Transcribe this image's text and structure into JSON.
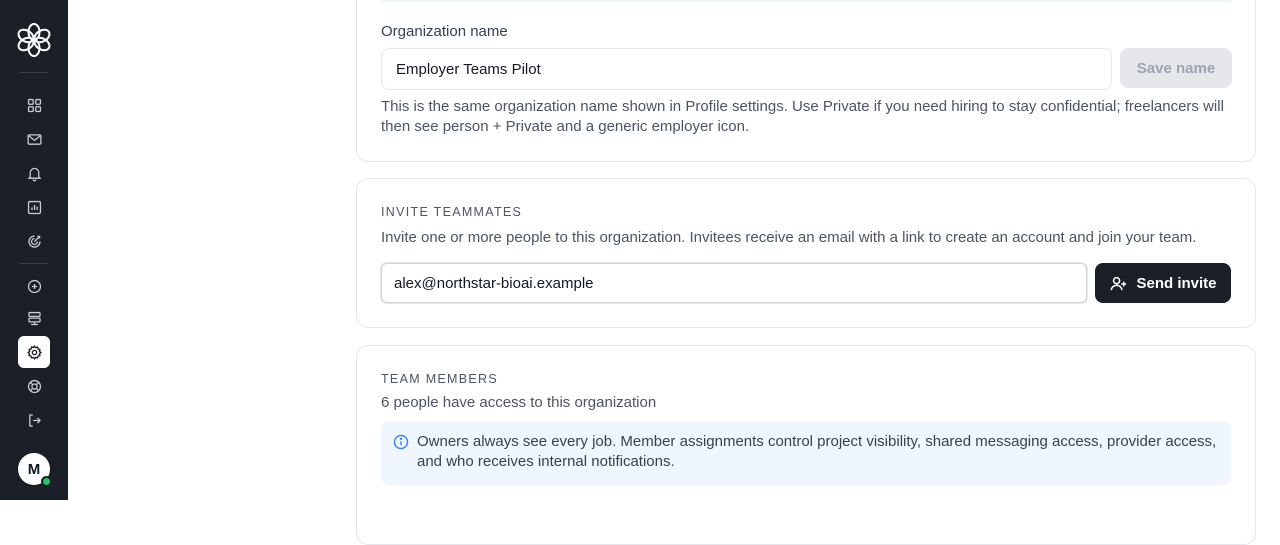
{
  "sidebar": {
    "avatar_initial": "M",
    "nav": [
      {
        "name": "dashboard",
        "icon": "grid-icon"
      },
      {
        "name": "messages",
        "icon": "mail-icon"
      },
      {
        "name": "notifications",
        "icon": "bell-icon"
      },
      {
        "name": "analytics",
        "icon": "chart-icon"
      },
      {
        "name": "goals",
        "icon": "target-icon"
      },
      {
        "name": "create",
        "icon": "plus-circle-icon"
      },
      {
        "name": "infrastructure",
        "icon": "server-icon"
      },
      {
        "name": "settings",
        "icon": "gear-icon",
        "active": true
      },
      {
        "name": "help",
        "icon": "lifebuoy-icon"
      },
      {
        "name": "logout",
        "icon": "logout-icon"
      }
    ]
  },
  "organization": {
    "label": "Organization name",
    "value": "Employer Teams Pilot",
    "save_label": "Save name",
    "help": "This is the same organization name shown in Profile settings. Use Private if you need hiring to stay confidential; freelancers will then see person + Private and a generic employer icon."
  },
  "invite": {
    "title": "INVITE TEAMMATES",
    "description": "Invite one or more people to this organization. Invitees receive an email with a link to create an account and join your team.",
    "email_value": "alex@northstar-bioai.example",
    "send_label": "Send invite"
  },
  "team": {
    "title": "TEAM MEMBERS",
    "count_text": "6 people have access to this organization",
    "info": "Owners always see every job. Member assignments control project visibility, shared messaging access, provider access, and who receives internal notifications."
  },
  "colors": {
    "sidebar_bg": "#1b1f27",
    "accent_dark": "#1b1f27",
    "info_bg": "#eff6ff",
    "info_icon": "#3b82f6",
    "status_online": "#22c55e"
  }
}
